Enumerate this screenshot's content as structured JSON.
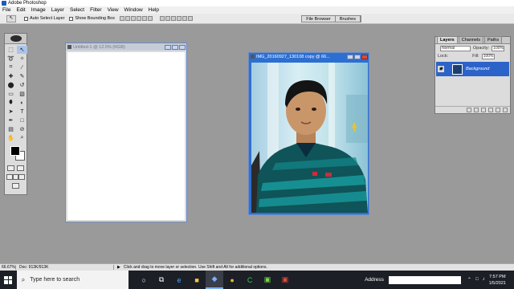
{
  "window": {
    "title": "Adobe Photoshop"
  },
  "menubar": {
    "items": [
      "File",
      "Edit",
      "Image",
      "Layer",
      "Select",
      "Filter",
      "View",
      "Window",
      "Help"
    ]
  },
  "options": {
    "auto_select_layer": "Auto Select Layer",
    "show_bounding_box": "Show Bounding Box",
    "palette_tabs": [
      "File Browser",
      "Brushes"
    ]
  },
  "documents": {
    "untitled": {
      "title": "Untitled-1 @ 12.5% (RGB)"
    },
    "photo": {
      "title": "IMG_20160927_130108 copy @ 66..."
    }
  },
  "layers_panel": {
    "tabs": [
      "Layers",
      "Channels",
      "Paths"
    ],
    "blend_mode": "Normal",
    "opacity_label": "Opacity:",
    "opacity_value": "100%",
    "lock_label": "Lock:",
    "fill_label": "Fill:",
    "fill_value": "100%",
    "layer_name": "Background"
  },
  "statusbar": {
    "zoom": "66.67%",
    "doc_size": "Doc: 913K/913K",
    "hint": "Click and drag to move layer or selection.  Use Shift and Alt for additional options."
  },
  "taskbar": {
    "search_placeholder": "Type here to search",
    "address_label": "Address",
    "time": "7:57 PM",
    "date": "1/5/2021"
  },
  "colors": {
    "accent": "#2b63c9",
    "taskbar": "#1c1f26",
    "workspace": "#9a9a9a"
  }
}
